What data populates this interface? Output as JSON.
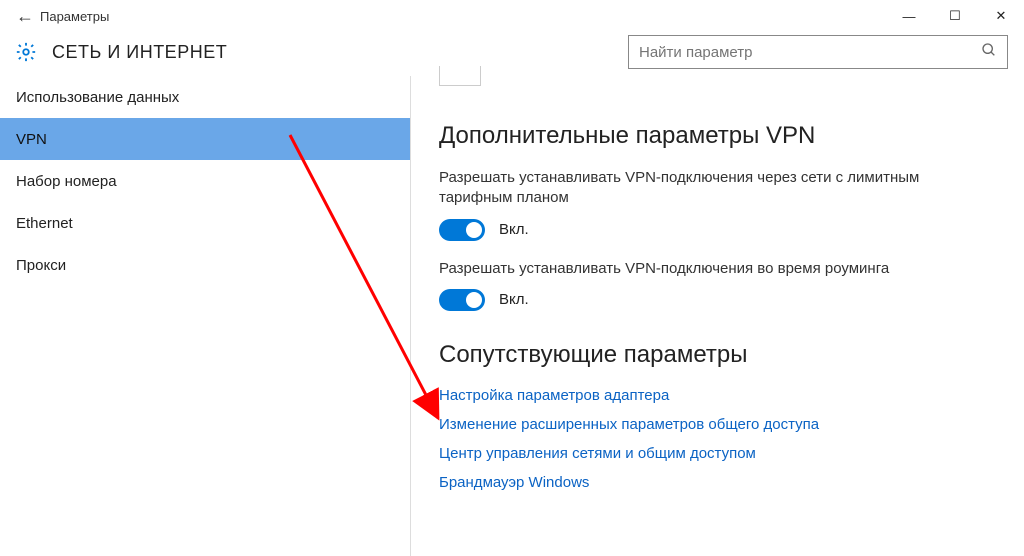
{
  "titlebar": {
    "back_glyph": "←",
    "title": "Параметры"
  },
  "window_controls": {
    "min": "—",
    "max": "☐",
    "close": "✕"
  },
  "header": {
    "section": "СЕТЬ И ИНТЕРНЕТ"
  },
  "search": {
    "placeholder": "Найти параметр"
  },
  "sidebar": {
    "items": [
      {
        "label": "Использование данных",
        "selected": false
      },
      {
        "label": "VPN",
        "selected": true
      },
      {
        "label": "Набор номера",
        "selected": false
      },
      {
        "label": "Ethernet",
        "selected": false
      },
      {
        "label": "Прокси",
        "selected": false
      }
    ]
  },
  "content": {
    "heading_vpn": "Дополнительные параметры VPN",
    "setting1": {
      "label": "Разрешать устанавливать VPN-подключения через сети с лимитным тарифным планом",
      "state": "Вкл."
    },
    "setting2": {
      "label": "Разрешать устанавливать VPN-подключения во время роуминга",
      "state": "Вкл."
    },
    "heading_related": "Сопутствующие параметры",
    "links": [
      "Настройка параметров адаптера",
      "Изменение расширенных параметров общего доступа",
      "Центр управления сетями и общим доступом",
      "Брандмауэр Windows"
    ]
  },
  "annotation": {
    "arrow_color": "#ff0000"
  }
}
